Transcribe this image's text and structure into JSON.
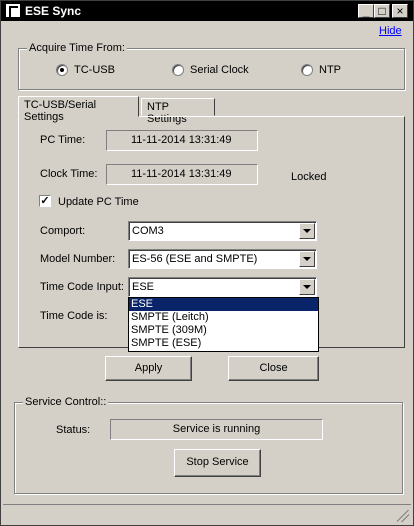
{
  "window": {
    "title": "ESE Sync",
    "hide_link": "Hide",
    "min_label": "_",
    "max_label": "□",
    "close_label": "×"
  },
  "acquire": {
    "title": "Acquire Time From:",
    "options": [
      {
        "label": "TC-USB",
        "selected": true
      },
      {
        "label": "Serial Clock",
        "selected": false
      },
      {
        "label": "NTP",
        "selected": false
      }
    ]
  },
  "tabs": [
    "TC-USB/Serial Settings",
    "NTP Settings"
  ],
  "settings": {
    "pc_time_label": "PC Time:",
    "pc_time_value": "11-11-2014  13:31:49",
    "clock_time_label": "Clock Time:",
    "clock_time_value": "11-11-2014  13:31:49",
    "lock_status": "Locked",
    "update_pc_time_label": "Update PC Time",
    "update_pc_time_checked": true,
    "comport_label": "Comport:",
    "comport_value": "COM3",
    "model_label": "Model Number:",
    "model_value": "ES-56 (ESE and SMPTE)",
    "tc_input_label": "Time Code Input:",
    "tc_input_value": "ESE",
    "tc_is_label": "Time Code is:",
    "tc_input_options": [
      "ESE",
      "SMPTE (Leitch)",
      "SMPTE (309M)",
      "SMPTE (ESE)"
    ]
  },
  "buttons": {
    "apply": "Apply",
    "close": "Close",
    "stop_service": "Stop Service"
  },
  "service": {
    "title": "Service Control::",
    "status_label": "Status:",
    "status_value": "Service is running"
  },
  "colors": {
    "face": "#d4d0c8",
    "titlebar": "#000000",
    "selection": "#0a246a",
    "link": "#0000ff"
  }
}
